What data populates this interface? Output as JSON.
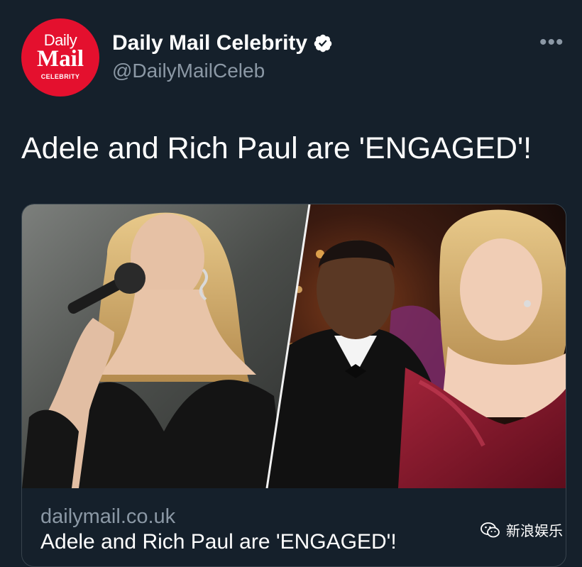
{
  "account": {
    "name": "Daily Mail Celebrity",
    "handle": "@DailyMailCeleb",
    "avatar_logo": {
      "line1": "Daily",
      "line2": "Mail",
      "line3": "CELEBRITY"
    }
  },
  "tweet": {
    "text": "Adele and Rich Paul are 'ENGAGED'!"
  },
  "card": {
    "domain": "dailymail.co.uk",
    "title": "Adele and Rich Paul are 'ENGAGED'!"
  },
  "watermark": {
    "text": "新浪娱乐"
  },
  "colors": {
    "background": "#15202b",
    "secondary_text": "#8b98a5",
    "card_border": "#38444d",
    "brand_red": "#e4102e"
  },
  "icons": [
    "verified-badge-icon",
    "more-options-icon",
    "wechat-icon"
  ]
}
